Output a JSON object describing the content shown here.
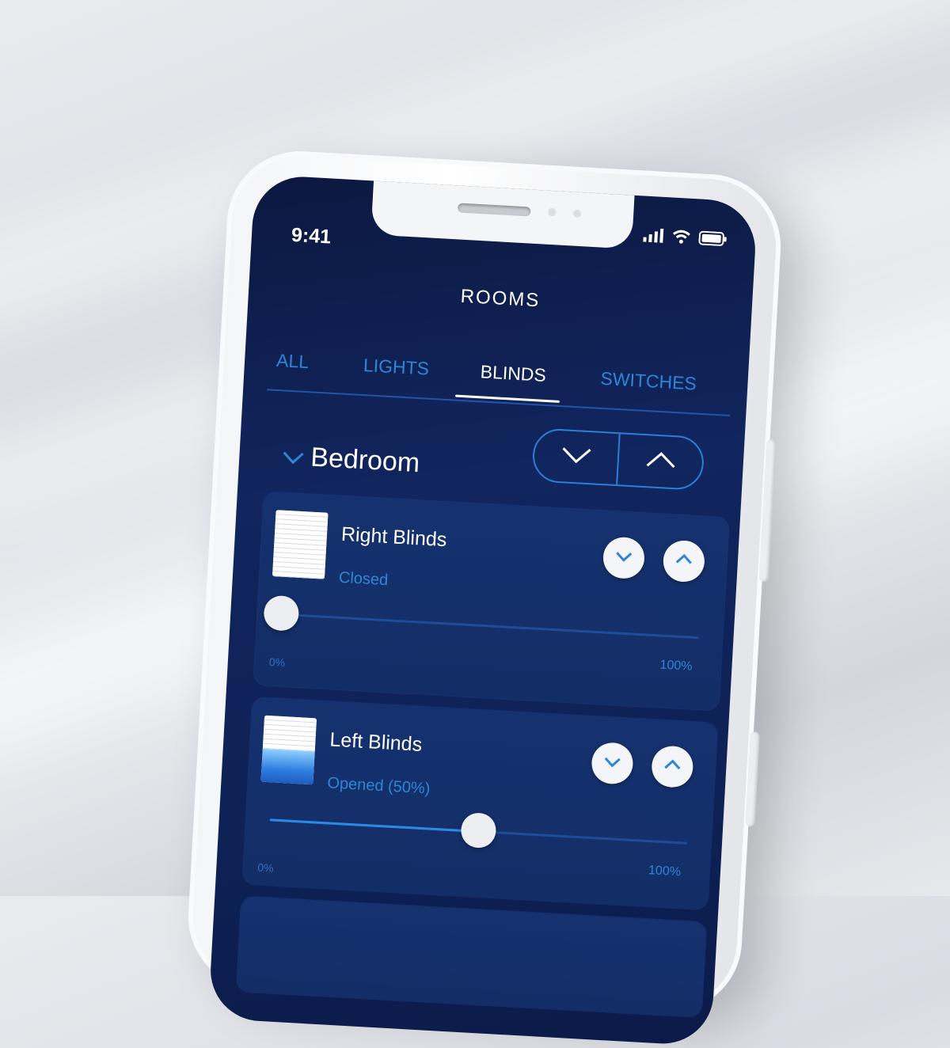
{
  "status_bar": {
    "time": "9:41",
    "icons": [
      "signal-icon",
      "wifi-icon",
      "battery-icon"
    ]
  },
  "header": {
    "title": "ROOMS"
  },
  "tabs": [
    {
      "label": "ALL",
      "active": false
    },
    {
      "label": "LIGHTS",
      "active": false
    },
    {
      "label": "BLINDS",
      "active": true
    },
    {
      "label": "SWITCHES",
      "active": false
    }
  ],
  "room": {
    "name": "Bedroom"
  },
  "blinds": [
    {
      "name": "Right Blinds",
      "status": "Closed",
      "level": 0,
      "min_label": "0%",
      "max_label": "100%"
    },
    {
      "name": "Left Blinds",
      "status": "Opened (50%)",
      "level": 0.5,
      "min_label": "0%",
      "max_label": "100%"
    }
  ],
  "colors": {
    "accent": "#2e86d6",
    "screen_bg": "#0e2257",
    "card_bg": "#14306a",
    "text": "#ffffff"
  }
}
